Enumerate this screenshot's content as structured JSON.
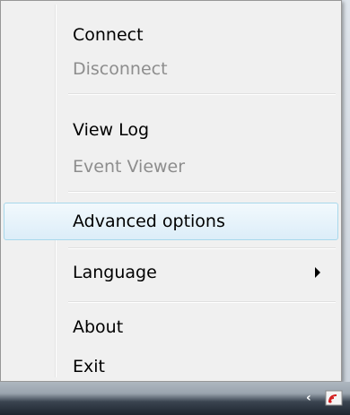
{
  "menu": {
    "items": [
      {
        "label": "Connect",
        "enabled": true
      },
      {
        "label": "Disconnect",
        "enabled": false
      },
      {
        "label": "View Log",
        "enabled": true
      },
      {
        "label": "Event Viewer",
        "enabled": false
      },
      {
        "label": "Advanced options",
        "enabled": true,
        "highlighted": true
      },
      {
        "label": "Language",
        "enabled": true,
        "has_submenu": true
      },
      {
        "label": "About",
        "enabled": true
      },
      {
        "label": "Exit",
        "enabled": true
      }
    ]
  },
  "taskbar": {
    "icons": [
      "show-hidden-icons-chevron",
      "network-signal-icon"
    ]
  },
  "colors": {
    "menu_background": "#f0f0f0",
    "disabled_text": "#8d8d8d",
    "highlight_border": "#a8d8eb",
    "tray_icon_red": "#d42020"
  }
}
